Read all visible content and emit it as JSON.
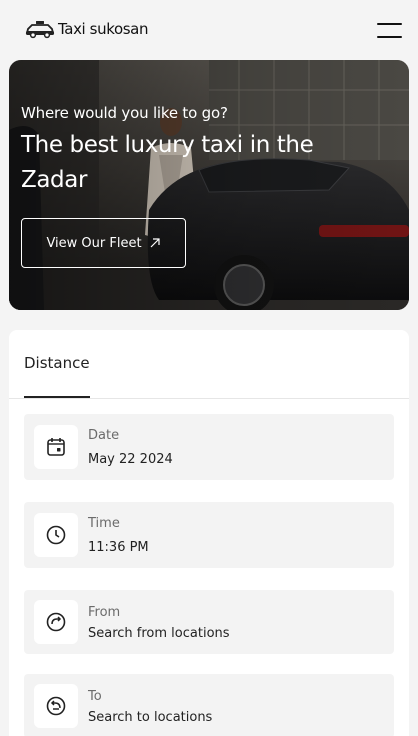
{
  "header": {
    "brand": "Taxi sukosan",
    "logo_icon": "taxi-car-icon",
    "menu_icon": "hamburger-menu-icon"
  },
  "hero": {
    "subtitle": "Where would you like to go?",
    "title": "The best luxury taxi in the Zadar",
    "button_label": "View Our Fleet",
    "button_icon": "arrow-up-right-icon"
  },
  "booking": {
    "tab_label": "Distance",
    "fields": [
      {
        "label": "Date",
        "value": "May 22 2024",
        "icon": "calendar-icon"
      },
      {
        "label": "Time",
        "value": "11:36 PM",
        "icon": "clock-icon"
      },
      {
        "label": "From",
        "value": "Search from locations",
        "icon": "route-arrow-icon"
      },
      {
        "label": "To",
        "value": "Search to locations",
        "icon": "return-arrow-icon"
      }
    ]
  },
  "colors": {
    "page_bg": "#f4f4f4",
    "text_dark": "#1a1a1a",
    "field_bg": "#f3f3f3",
    "label_gray": "#6b6b6b"
  }
}
